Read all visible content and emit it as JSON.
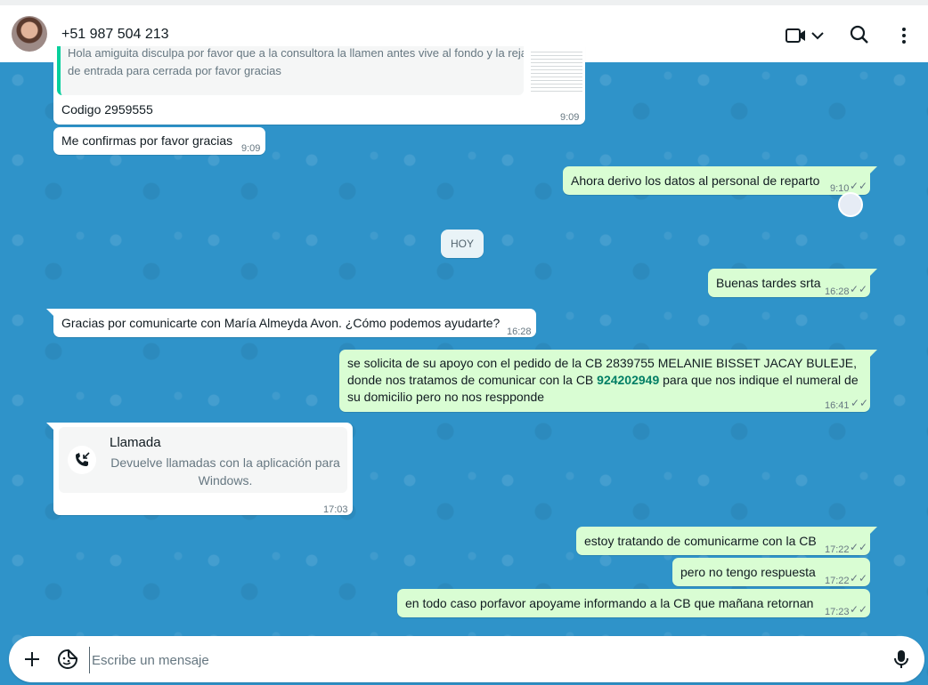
{
  "header": {
    "contact_name": "+51 987 504 213",
    "icons": [
      "video-call-icon",
      "chevron-down-icon",
      "search-icon",
      "menu-icon"
    ]
  },
  "messages": {
    "quoted_text": "Hola amiguita disculpa por favor que a la consultora la llamen antes vive al fondo y la reja de entrada para cerrada por favor gracias",
    "m1_text": "Codigo 2959555",
    "m1_time": "9:09",
    "m2_text": "Me confirmas por favor gracias",
    "m2_time": "9:09",
    "m3_text": "Ahora derivo los datos al personal de reparto",
    "m3_time": "9:10",
    "day_separator": "HOY",
    "m4_text": "Buenas tardes srta",
    "m4_time": "16:28",
    "m5_text": "Gracias por comunicarte con María Almeyda Avon. ¿Cómo podemos ayudarte?",
    "m5_time": "16:28",
    "m6_text_a": "se solicita de su apoyo con el pedido de la CB 2839755 MELANIE BISSET JACAY BULEJE, donde nos tratamos de comunicar con la CB ",
    "m6_phone": "924202949",
    "m6_text_b": " para que nos indique el numeral de su domicilio pero no nos respponde",
    "m6_time": "16:41",
    "call_title": "Llamada",
    "call_subtitle": "Devuelve llamadas con la aplicación para Windows.",
    "call_time": "17:03",
    "m7_text": "estoy tratando de comunicarme con la CB",
    "m7_time": "17:22",
    "m8_text": "pero no tengo respuesta",
    "m8_time": "17:22",
    "m9_text": "en todo caso porfavor apoyame informando a la CB que mañana retornan",
    "m9_time": "17:23"
  },
  "composer": {
    "placeholder": "Escribe un mensaje"
  },
  "colors": {
    "outgoing_bubble": "#d9fdd3",
    "incoming_bubble": "#ffffff",
    "chat_background": "#2f93c9",
    "phone_link": "#027e65"
  }
}
